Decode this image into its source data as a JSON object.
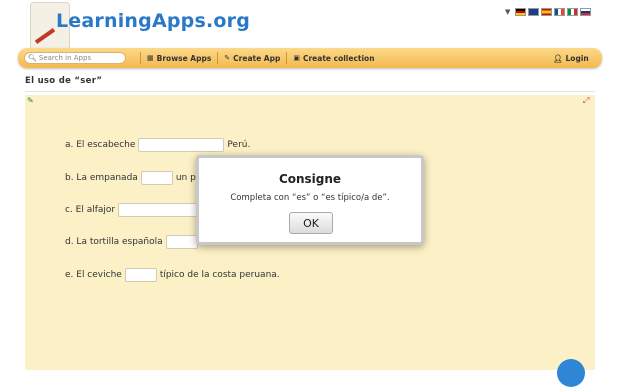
{
  "header": {
    "logo_text": "LearningApps.org",
    "language_flags": [
      "de-flag-icon",
      "gb-flag-icon",
      "es-flag-icon",
      "fr-flag-icon",
      "it-flag-icon",
      "ru-flag-icon"
    ]
  },
  "nav": {
    "search_placeholder": "Search in Apps",
    "browse_label": "Browse Apps",
    "create_label": "Create App",
    "collection_label": "Create collection",
    "login_label": "Login"
  },
  "page": {
    "title": "El uso de “ser”"
  },
  "exercise": {
    "lines": [
      {
        "before": "a. El escabeche",
        "value": "",
        "after": "Perú."
      },
      {
        "before": "b. La empanada",
        "value": "",
        "after": "un p"
      },
      {
        "before": "c. El alfajor",
        "value": "",
        "after": ""
      },
      {
        "before": "d. La tortilla española",
        "value": "",
        "after": ""
      },
      {
        "before": "e. El ceviche",
        "value": "",
        "after": "típico de la costa peruana."
      }
    ]
  },
  "dialog": {
    "title": "Consigne",
    "text": "Completa con “es” o “es típico/a de”.",
    "ok_label": "OK"
  },
  "colors": {
    "nav_orange": "#f3b94e",
    "app_background": "#fbf0c6",
    "logo_blue": "#2a78c8"
  }
}
